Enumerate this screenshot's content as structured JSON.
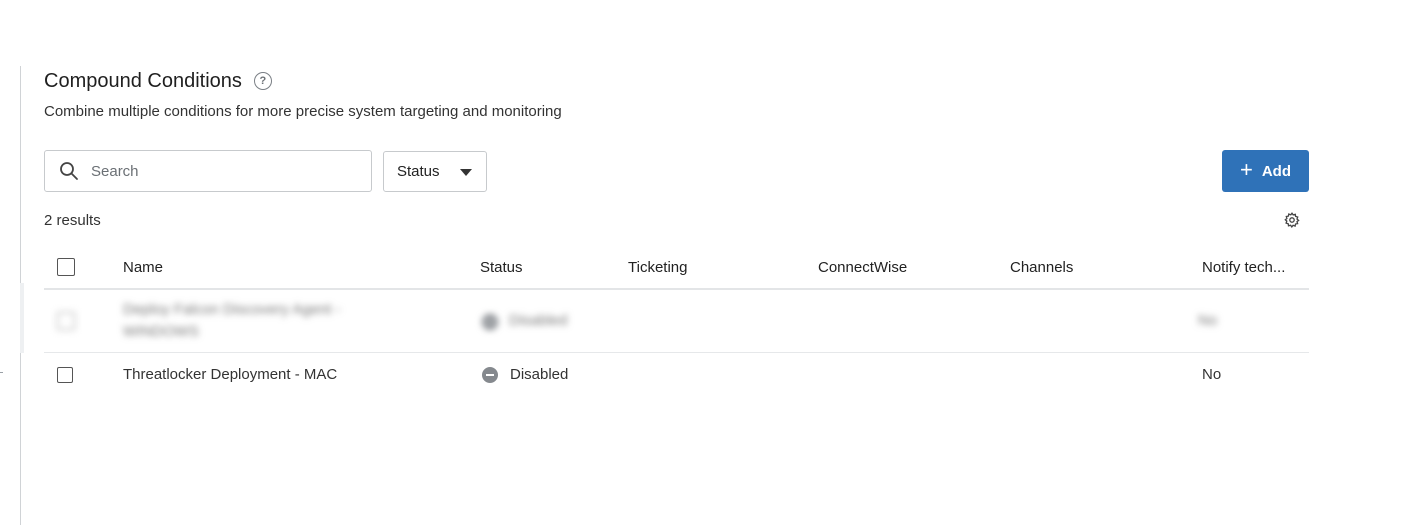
{
  "header": {
    "title": "Compound Conditions",
    "subtitle": "Combine multiple conditions for more precise system targeting and monitoring"
  },
  "toolbar": {
    "search_placeholder": "Search",
    "status_filter_label": "Status",
    "add_label": "Add"
  },
  "results_count": "2 results",
  "table": {
    "columns": [
      "Name",
      "Status",
      "Ticketing",
      "ConnectWise",
      "Channels",
      "Notify tech..."
    ],
    "rows": [
      {
        "name": "Deploy Falcon Discovery Agent - WINDOWS",
        "status": "Disabled",
        "ticketing": "",
        "connectwise": "",
        "channels": "",
        "notify": "No",
        "blurred": true
      },
      {
        "name": "Threatlocker Deployment - MAC",
        "status": "Disabled",
        "ticketing": "",
        "connectwise": "",
        "channels": "",
        "notify": "No",
        "blurred": false
      }
    ]
  },
  "colors": {
    "accent": "#2f72b8",
    "status_disabled": "#85898e"
  }
}
